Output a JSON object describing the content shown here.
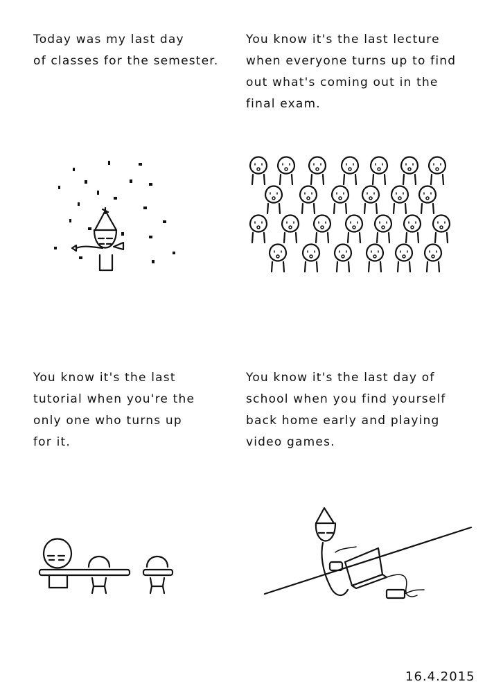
{
  "panels": [
    {
      "caption": "Today was my last day\nof classes for the semester."
    },
    {
      "caption": "You know it's the last lecture\nwhen everyone turns up to find\nout what's coming out in the\nfinal exam."
    },
    {
      "caption": "You know it's the last\ntutorial when you're the\nonly one who turns up\nfor it."
    },
    {
      "caption": "You know it's the last day of\nschool when you find yourself\nback home early and playing\nvideo games."
    }
  ],
  "date": "16.4.2015",
  "icons": [
    "party-hat-icon",
    "confetti-icon",
    "party-horn-icon",
    "student-face-icon",
    "empty-chair-icon",
    "laptop-icon",
    "game-controller-icon"
  ]
}
